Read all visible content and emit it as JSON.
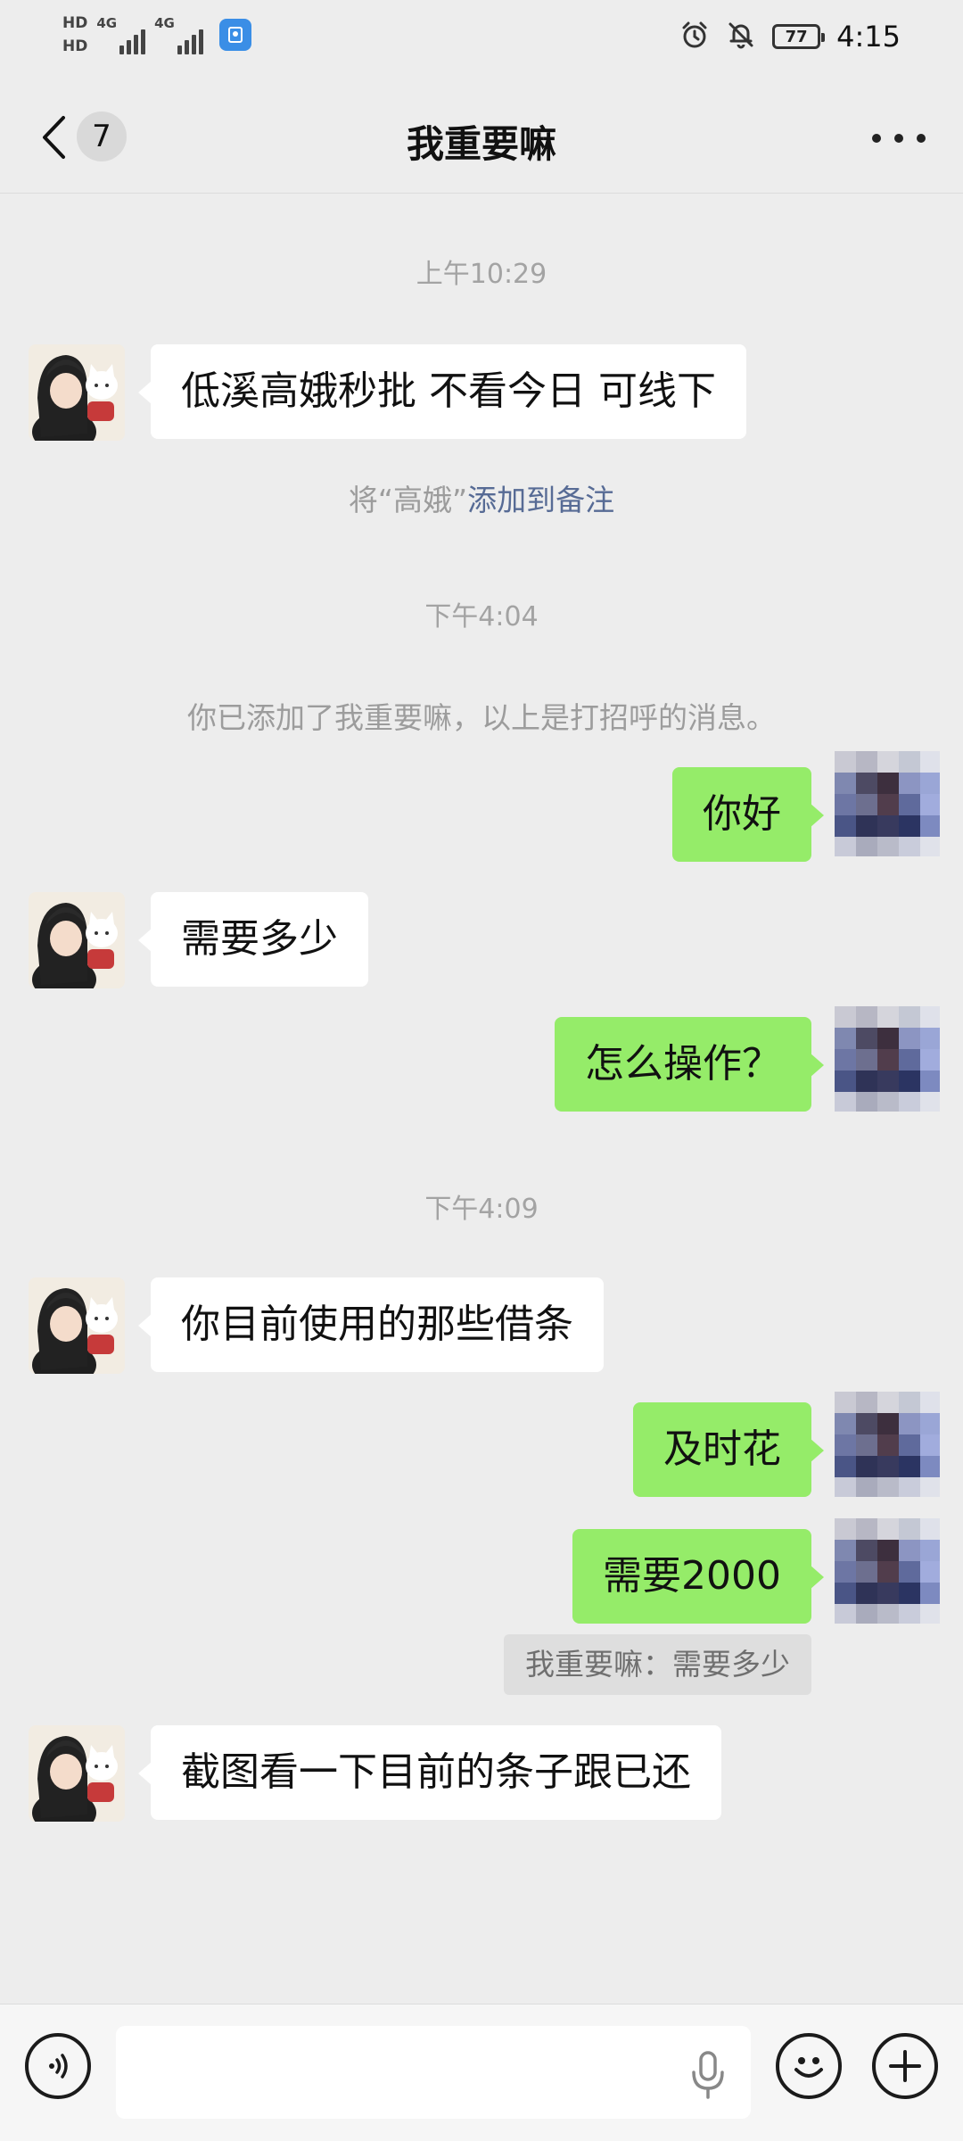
{
  "status_bar": {
    "sim1_label": "HD",
    "sim2_label": "HD",
    "network1": "4G",
    "network2": "4G",
    "battery": "77",
    "time": "4:15",
    "icons": [
      "alarm-icon",
      "mute-bell-icon",
      "battery-icon"
    ]
  },
  "nav": {
    "unread_count": "7",
    "title": "我重要嘛",
    "icons": [
      "chevron-left-icon",
      "more-icon"
    ]
  },
  "messages": [
    {
      "type": "time",
      "text": "上午10:29"
    },
    {
      "type": "in",
      "text": "低溪高娥秒批 不看今日 可线下"
    },
    {
      "type": "system_prompt",
      "prefix": "将“高娥”",
      "link": "添加到备注"
    },
    {
      "type": "time",
      "text": "下午4:04"
    },
    {
      "type": "system",
      "text": "你已添加了我重要嘛，以上是打招呼的消息。"
    },
    {
      "type": "out",
      "text": "你好"
    },
    {
      "type": "in",
      "text": "需要多少"
    },
    {
      "type": "out",
      "text": "怎么操作？"
    },
    {
      "type": "time",
      "text": "下午4:09"
    },
    {
      "type": "in",
      "text": "你目前使用的那些借条"
    },
    {
      "type": "out",
      "text": "及时花"
    },
    {
      "type": "out",
      "text": "需要2000"
    },
    {
      "type": "quote",
      "text": "我重要嘛：需要多少"
    },
    {
      "type": "in",
      "text": "截图看一下目前的条子跟已还"
    }
  ],
  "input_bar": {
    "placeholder": "",
    "icons": [
      "voice-icon",
      "microphone-icon",
      "emoji-icon",
      "plus-icon"
    ]
  },
  "colors": {
    "background": "#ededed",
    "incoming_bubble": "#ffffff",
    "outgoing_bubble": "#95ec69",
    "link": "#576b95",
    "timestamp": "#a3a3a3"
  }
}
